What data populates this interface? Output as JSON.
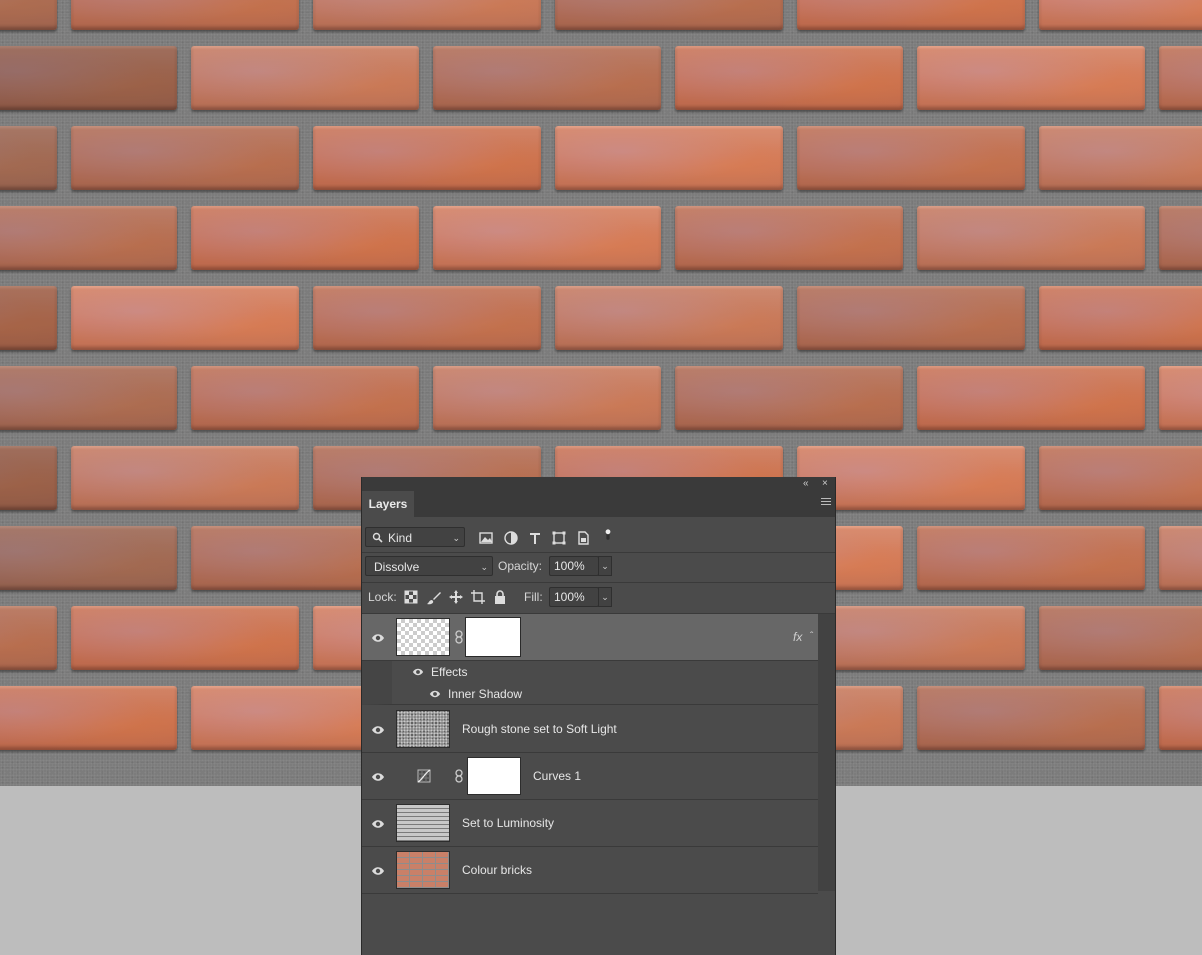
{
  "panel": {
    "tab_label": "Layers",
    "collapse_glyph": "«",
    "close_glyph": "×",
    "filter": {
      "kind_label": "Kind"
    },
    "blend_mode": "Dissolve",
    "opacity_label": "Opacity:",
    "opacity_value": "100%",
    "lock_label": "Lock:",
    "fill_label": "Fill:",
    "fill_value": "100%"
  },
  "layers": [
    {
      "name": "",
      "visible": true,
      "selected": true,
      "thumbnail": "transparent-checker",
      "has_mask": true,
      "fx": "fx",
      "effects_label": "Effects",
      "effects": [
        "Inner Shadow"
      ]
    },
    {
      "name": "Rough stone set to Soft Light",
      "visible": true,
      "thumbnail": "stone-texture"
    },
    {
      "name": "Curves 1",
      "visible": true,
      "thumbnail": "curves-adjustment-icon",
      "has_mask": true
    },
    {
      "name": "Set to Luminosity",
      "visible": true,
      "thumbnail": "gray-lines-texture"
    },
    {
      "name": "Colour bricks",
      "visible": true,
      "thumbnail": "brick-texture"
    }
  ],
  "colors": {
    "panel_bg": "#4b4b4b",
    "selected_row": "#676767",
    "brick": "#c67458",
    "mortar": "#7c7c7c",
    "pasteboard": "#bdbdbd"
  }
}
